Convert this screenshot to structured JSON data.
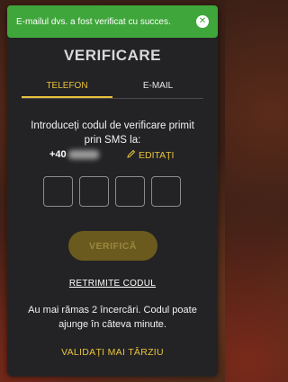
{
  "toast": {
    "message": "E-mailul dvs. a fost verificat cu succes.",
    "close_icon": "close-icon",
    "color": "#3fa63b"
  },
  "modal": {
    "title": "VERIFICARE",
    "tabs": [
      {
        "label": "TELEFON",
        "active": true
      },
      {
        "label": "E-MAIL",
        "active": false
      }
    ],
    "instructions": "Introduceți codul de verificare primit prin SMS la:",
    "phone_prefix": "+40",
    "edit_label": "EDITAȚI",
    "edit_icon": "pencil-icon",
    "code_digits": [
      "",
      "",
      "",
      ""
    ],
    "verify_label": "VERIFICĂ",
    "resend_label": "RETRIMITE CODUL",
    "attempts_text": "Au mai rămas 2 încercări. Codul poate ajunge în câteva minute.",
    "later_label": "VALIDAȚI MAI TÂRZIU",
    "accent_color": "#e8c33c"
  }
}
